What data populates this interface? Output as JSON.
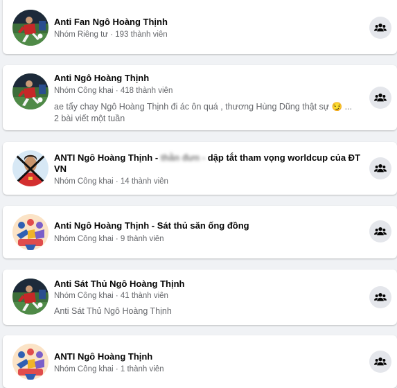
{
  "groups": [
    {
      "title": "Anti Fan Ngô Hoàng Thịnh",
      "privacy": "Nhóm Riêng tư",
      "members": "193 thành viên",
      "avatar": "football-player-photo",
      "action_icon": "people-icon"
    },
    {
      "title": "Anti Ngô Hoàng Thịnh",
      "privacy": "Nhóm Công khai",
      "members": "418 thành viên",
      "snippet": "ae tẩy chay Ngô Hoàng Thịnh đi ác ôn quá , thương Hùng Dũng thật sự 😏 ...",
      "activity": "2 bài viết một tuần",
      "avatar": "football-player-photo",
      "action_icon": "people-icon"
    },
    {
      "title_before": "ANTI Ngô Hoàng Thịnh - ",
      "title_blurred": "thằn đưn -",
      "title_after": " dập tắt tham vọng worldcup của ĐT VN",
      "privacy": "Nhóm Công khai",
      "members": "14 thành viên",
      "avatar": "player-crossed-out-photo",
      "action_icon": "people-icon"
    },
    {
      "title": "Anti Ngô Hoàng Thịnh - Sát thủ săn ống đồng",
      "privacy": "Nhóm Công khai",
      "members": "9 thành viên",
      "avatar": "group-illustration",
      "action_icon": "people-icon"
    },
    {
      "title": "Anti Sát Thủ Ngô Hoàng Thịnh",
      "privacy": "Nhóm Công khai",
      "members": "41 thành viên",
      "snippet": "Anti Sát Thủ Ngô Hoàng Thịnh",
      "avatar": "football-player-photo",
      "action_icon": "people-icon"
    },
    {
      "title": "ANTI Ngô Hoàng Thịnh",
      "privacy": "Nhóm Công khai",
      "members": "1 thành viên",
      "avatar": "group-illustration",
      "action_icon": "people-icon"
    }
  ],
  "separator": " · ",
  "colors": {
    "background": "#f0f2f5",
    "card": "#ffffff",
    "title": "#050505",
    "secondary": "#65676b",
    "button": "#e4e6eb"
  }
}
